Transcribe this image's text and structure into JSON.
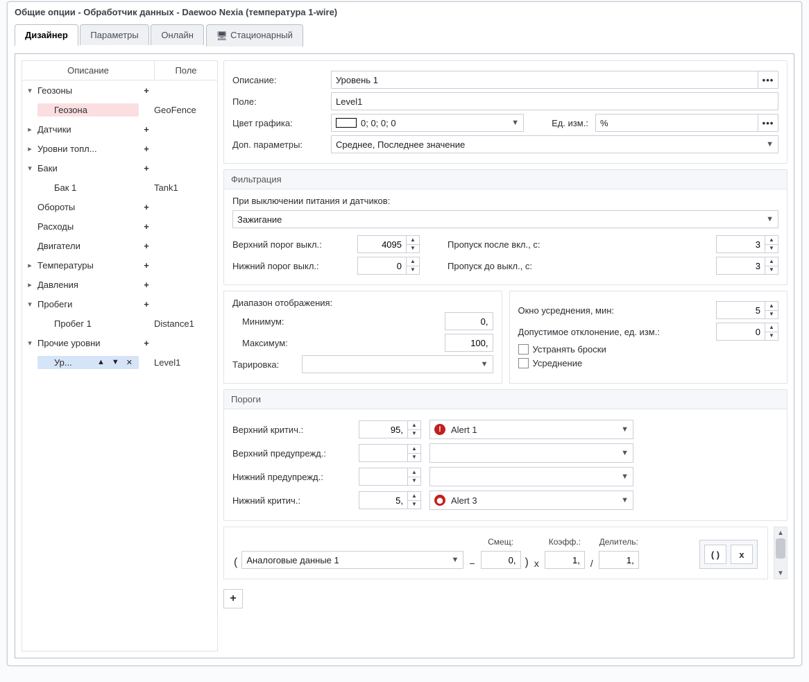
{
  "window_title": "Общие опции - Обработчик данных - Daewoo Nexia (температура 1-wire)",
  "tabs": [
    "Дизайнер",
    "Параметры",
    "Онлайн",
    "Стационарный"
  ],
  "active_tab": 0,
  "tree": {
    "col_desc": "Описание",
    "col_field": "Поле",
    "rows": [
      {
        "arrow": "▾",
        "indent": 0,
        "label": "Геозоны",
        "plus": "+",
        "field": ""
      },
      {
        "arrow": "",
        "indent": 1,
        "label": "Геозона",
        "plus": "",
        "field": "GeoFence",
        "sel": "red"
      },
      {
        "arrow": "▸",
        "indent": 0,
        "label": "Датчики",
        "plus": "+",
        "field": ""
      },
      {
        "arrow": "▸",
        "indent": 0,
        "label": "Уровни топл...",
        "plus": "+",
        "field": ""
      },
      {
        "arrow": "▾",
        "indent": 0,
        "label": "Баки",
        "plus": "+",
        "field": ""
      },
      {
        "arrow": "",
        "indent": 1,
        "label": "Бак 1",
        "plus": "",
        "field": "Tank1"
      },
      {
        "arrow": "",
        "indent": 0,
        "label": "Обороты",
        "plus": "+",
        "field": ""
      },
      {
        "arrow": "",
        "indent": 0,
        "label": "Расходы",
        "plus": "+",
        "field": ""
      },
      {
        "arrow": "",
        "indent": 0,
        "label": "Двигатели",
        "plus": "+",
        "field": ""
      },
      {
        "arrow": "▸",
        "indent": 0,
        "label": "Температуры",
        "plus": "+",
        "field": ""
      },
      {
        "arrow": "▸",
        "indent": 0,
        "label": "Давления",
        "plus": "+",
        "field": ""
      },
      {
        "arrow": "▾",
        "indent": 0,
        "label": "Пробеги",
        "plus": "+",
        "field": ""
      },
      {
        "arrow": "",
        "indent": 1,
        "label": "Пробег 1",
        "plus": "",
        "field": "Distance1"
      },
      {
        "arrow": "▾",
        "indent": 0,
        "label": "Прочие уровни",
        "plus": "+",
        "field": ""
      },
      {
        "arrow": "",
        "indent": 1,
        "label": "Ур...",
        "plus": "",
        "field": "Level1",
        "sel": "blue",
        "tools": true
      }
    ]
  },
  "details": {
    "descr_label": "Описание:",
    "descr_value": "Уровень 1",
    "field_label": "Поле:",
    "field_value": "Level1",
    "color_label": "Цвет графика:",
    "color_value": "0; 0; 0; 0",
    "unit_label": "Ед. изм.:",
    "unit_value": "%",
    "extra_label": "Доп. параметры:",
    "extra_value": "Среднее, Последнее значение"
  },
  "filter": {
    "title": "Фильтрация",
    "power_label": "При выключении питания и датчиков:",
    "power_value": "Зажигание",
    "upper_off_label": "Верхний порог выкл.:",
    "upper_off_value": "4095",
    "skip_after_on_label": "Пропуск после вкл., с:",
    "skip_after_on_value": "3",
    "lower_off_label": "Нижний порог выкл.:",
    "lower_off_value": "0",
    "skip_before_off_label": "Пропуск до выкл., с:",
    "skip_before_off_value": "3"
  },
  "range": {
    "title": "Диапазон отображения:",
    "min_label": "Минимум:",
    "min_value": "0,",
    "max_label": "Максимум:",
    "max_value": "100,",
    "tare_label": "Тарировка:",
    "tare_value": ""
  },
  "avg": {
    "window_label": "Окно усреднения, мин:",
    "window_value": "5",
    "tol_label": "Допустимое отклонение, ед. изм.:",
    "tol_value": "0",
    "remove_spikes": "Устранять броски",
    "averaging": "Усреднение"
  },
  "thresh": {
    "title": "Пороги",
    "upper_crit_label": "Верхний критич.:",
    "upper_crit_value": "95,",
    "upper_crit_alert": "Alert 1",
    "upper_warn_label": "Верхний предупрежд.:",
    "upper_warn_value": "",
    "upper_warn_alert": "",
    "lower_warn_label": "Нижний предупрежд.:",
    "lower_warn_value": "",
    "lower_warn_alert": "",
    "lower_crit_label": "Нижний критич.:",
    "lower_crit_value": "5,",
    "lower_crit_alert": "Alert 3"
  },
  "formula": {
    "source": "Аналоговые данные 1",
    "offset_label": "Смещ:",
    "offset_value": "0,",
    "coef_label": "Коэфф.:",
    "coef_value": "1,",
    "div_label": "Делитель:",
    "div_value": "1,",
    "paren_btn": "( )",
    "x_btn": "x",
    "add_btn": "+"
  }
}
